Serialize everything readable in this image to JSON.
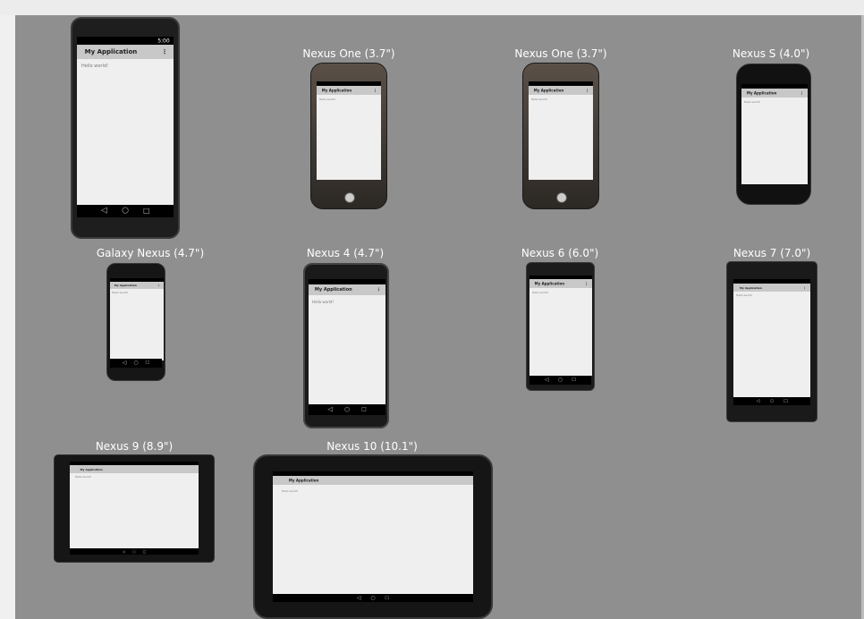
{
  "app_title": "My Application",
  "hello_text": "Hello world!",
  "status_time": "5:00",
  "overflow_glyph": "⋮",
  "devices": [
    {
      "id": "generic",
      "label": ""
    },
    {
      "id": "nexus-one-a",
      "label": "Nexus One (3.7\")"
    },
    {
      "id": "nexus-one-b",
      "label": "Nexus One (3.7\")"
    },
    {
      "id": "nexus-s",
      "label": "Nexus S (4.0\")"
    },
    {
      "id": "galaxy-nexus",
      "label": "Galaxy Nexus (4.7\")"
    },
    {
      "id": "nexus-4",
      "label": "Nexus 4 (4.7\")"
    },
    {
      "id": "nexus-6",
      "label": "Nexus 6 (6.0\")"
    },
    {
      "id": "nexus-7",
      "label": "Nexus 7 (7.0\")"
    },
    {
      "id": "nexus-9",
      "label": "Nexus 9 (8.9\")"
    },
    {
      "id": "nexus-10",
      "label": "Nexus 10 (10.1\")"
    }
  ],
  "nav_icons": [
    "back-icon",
    "home-icon",
    "recents-icon"
  ],
  "colors": {
    "canvas": "#8f8f8f",
    "device_body": "#1c1c1c",
    "screen": "#efefef",
    "action_bar": "#c8c8c8",
    "status_bar": "#000000"
  }
}
